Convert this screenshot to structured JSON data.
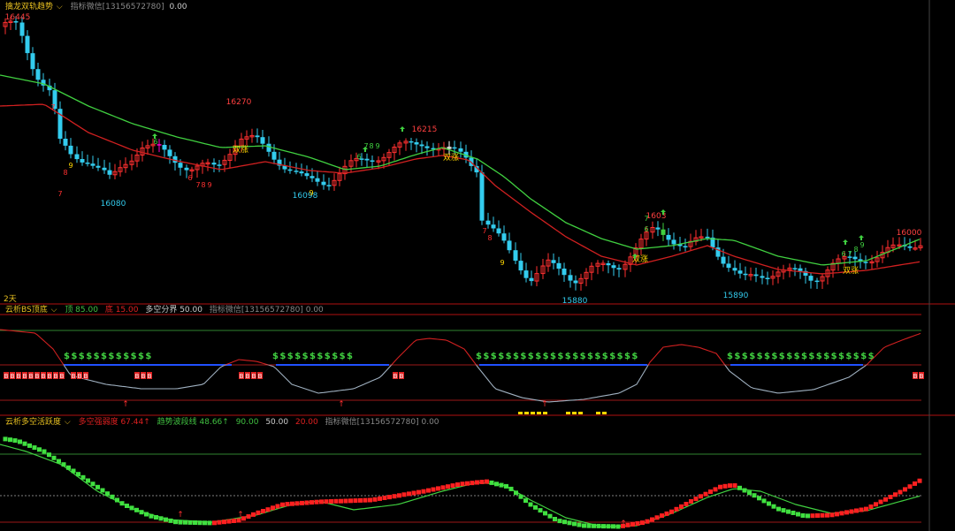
{
  "top": {
    "indicator_name": "擒龙双轨趋势",
    "dropdown_icon": "chevron-down-icon",
    "wechat_label": "指标微信[13156572780]",
    "value": "0.00",
    "price_labels": [
      {
        "text": "16445",
        "color": "#ff4040"
      },
      {
        "text": "16270",
        "color": "#ff4040"
      },
      {
        "text": "16215",
        "color": "#ff4040"
      },
      {
        "text": "16000",
        "color": "#ff4040"
      },
      {
        "text": "16080",
        "color": "#33ccee"
      },
      {
        "text": "16098",
        "color": "#33ccee"
      },
      {
        "text": "15880",
        "color": "#33ccee"
      },
      {
        "text": "15890",
        "color": "#33ccee"
      },
      {
        "text": "1603",
        "color": "#ff4040"
      }
    ],
    "signal_text": "双涨",
    "period_label": "2天"
  },
  "mid": {
    "indicator_name": "云析BS顶底",
    "dropdown_icon": "chevron-down-icon",
    "items": [
      {
        "text": "顶 85.00",
        "color": "#40c040"
      },
      {
        "text": "底 15.00",
        "color": "#e02020"
      },
      {
        "text": "多空分界 50.00",
        "color": "#cccccc"
      },
      {
        "text": "指标微信[13156572780] 0.00",
        "color": "#888888"
      }
    ],
    "dollar_row": "$$$$$$$$$$$$$$$$$$$$$$",
    "bb": "BB",
    "bbbb": "BBBB"
  },
  "bot": {
    "indicator_name": "云析多空活跃度",
    "dropdown_icon": "chevron-down-icon",
    "items": [
      {
        "text": "多空强弱度 67.44↑",
        "color": "#e02020"
      },
      {
        "text": "趋势波段线 48.66↑",
        "color": "#40c040"
      },
      {
        "text": "90.00",
        "color": "#40c040"
      },
      {
        "text": "50.00",
        "color": "#cccccc"
      },
      {
        "text": "20.00",
        "color": "#e02020"
      },
      {
        "text": "指标微信[13156572780] 0.00",
        "color": "#888888"
      }
    ]
  },
  "colors": {
    "up": "#ff3030",
    "down": "#33ccee",
    "green": "#40d040",
    "red_line": "#d02020",
    "yellow": "#ffd700",
    "magenta": "#ff00cc",
    "white": "#ffffff"
  },
  "chart_data": [
    {
      "type": "line",
      "series": [
        {
          "values": [
            16445,
            16380,
            16300,
            16200,
            16120,
            16080,
            16140,
            16160,
            16110,
            16150,
            16270,
            16230,
            16170,
            16140,
            16098,
            16130,
            16170,
            16200,
            16215,
            16190,
            16170,
            15950,
            15900,
            15880,
            15900,
            15920,
            15950,
            15980,
            16030,
            16010,
            15960,
            15890,
            15910,
            15930,
            15940,
            15950,
            15960,
            15980,
            16000
          ]
        }
      ]
    },
    {
      "type": "line",
      "ylim": [
        0,
        100
      ],
      "levels": [
        85,
        50,
        15
      ]
    },
    {
      "type": "line",
      "ylim": [
        0,
        100
      ],
      "levels": [
        90,
        50,
        20
      ]
    }
  ]
}
